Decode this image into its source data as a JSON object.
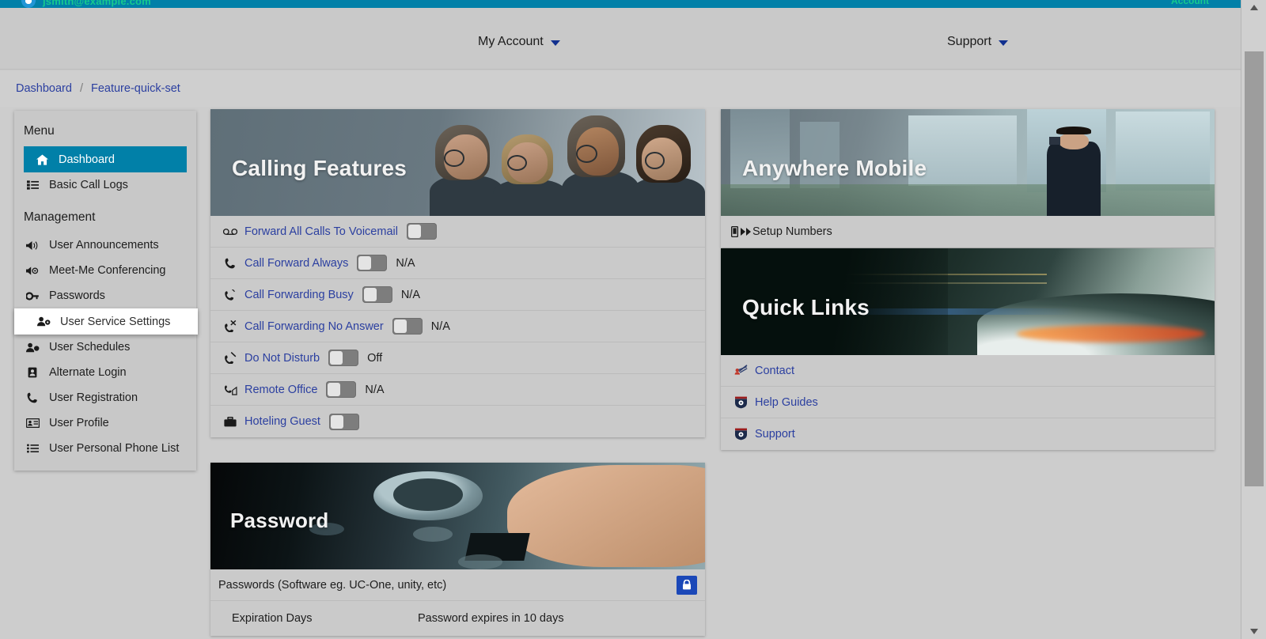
{
  "brand": {
    "email": "jsmith@example.com",
    "right_label": "Account"
  },
  "topnav": {
    "my_account": "My Account",
    "support": "Support"
  },
  "breadcrumb": {
    "root": "Dashboard",
    "separator": "/",
    "current": "Feature-quick-set"
  },
  "sidebar": {
    "menu_heading": "Menu",
    "management_heading": "Management",
    "menu_items": [
      {
        "label": "Dashboard",
        "icon": "home-icon",
        "state": "active"
      },
      {
        "label": "Basic Call Logs",
        "icon": "list-icon",
        "state": "normal"
      }
    ],
    "management_items": [
      {
        "label": "User Announcements",
        "icon": "megaphone-icon",
        "state": "normal"
      },
      {
        "label": "Meet-Me Conferencing",
        "icon": "conference-icon",
        "state": "normal"
      },
      {
        "label": "Passwords",
        "icon": "key-icon",
        "state": "normal"
      },
      {
        "label": "User Service Settings",
        "icon": "user-gear-icon",
        "state": "hovered"
      },
      {
        "label": "User Schedules",
        "icon": "user-clock-icon",
        "state": "normal"
      },
      {
        "label": "Alternate Login",
        "icon": "id-badge-icon",
        "state": "normal"
      },
      {
        "label": "User Registration",
        "icon": "phone-icon",
        "state": "normal"
      },
      {
        "label": "User Profile",
        "icon": "id-card-icon",
        "state": "normal"
      },
      {
        "label": "User Personal Phone List",
        "icon": "list-icon",
        "state": "normal"
      }
    ]
  },
  "calling_features": {
    "banner_title": "Calling Features",
    "rows": [
      {
        "label": "Forward All Calls To Voicemail",
        "icon": "voicemail-icon",
        "toggle": "off",
        "state": ""
      },
      {
        "label": "Call Forward Always",
        "icon": "phone-icon",
        "toggle": "off",
        "state": "N/A"
      },
      {
        "label": "Call Forwarding Busy",
        "icon": "phone-busy-icon",
        "toggle": "off",
        "state": "N/A"
      },
      {
        "label": "Call Forwarding No Answer",
        "icon": "phone-slash-icon",
        "toggle": "off",
        "state": "N/A"
      },
      {
        "label": "Do Not Disturb",
        "icon": "phone-mute-icon",
        "toggle": "off",
        "state": "Off"
      },
      {
        "label": "Remote Office",
        "icon": "home-phone-icon",
        "toggle": "off",
        "state": "N/A"
      },
      {
        "label": "Hoteling Guest",
        "icon": "briefcase-icon",
        "toggle": "off",
        "state": ""
      }
    ]
  },
  "anywhere_mobile": {
    "banner_title": "Anywhere Mobile",
    "rows": [
      {
        "label": "Setup Numbers",
        "icon": "mobile-forward-icon"
      }
    ]
  },
  "quick_links": {
    "banner_title": "Quick Links",
    "rows": [
      {
        "label": "Contact",
        "icon": "contact-icon"
      },
      {
        "label": "Help Guides",
        "icon": "crest-icon"
      },
      {
        "label": "Support",
        "icon": "crest-icon"
      }
    ]
  },
  "password": {
    "banner_title": "Password",
    "header": "Passwords (Software eg. UC-One, unity, etc)",
    "lock_button_icon": "lock-icon",
    "rows": [
      {
        "key": "Expiration Days",
        "value": "Password expires in 10 days"
      }
    ]
  },
  "colors": {
    "brand_teal": "#0180a8",
    "link_blue": "#2b3fa0",
    "page_bg": "#cdcdcd",
    "lock_button": "#1b48b8"
  }
}
